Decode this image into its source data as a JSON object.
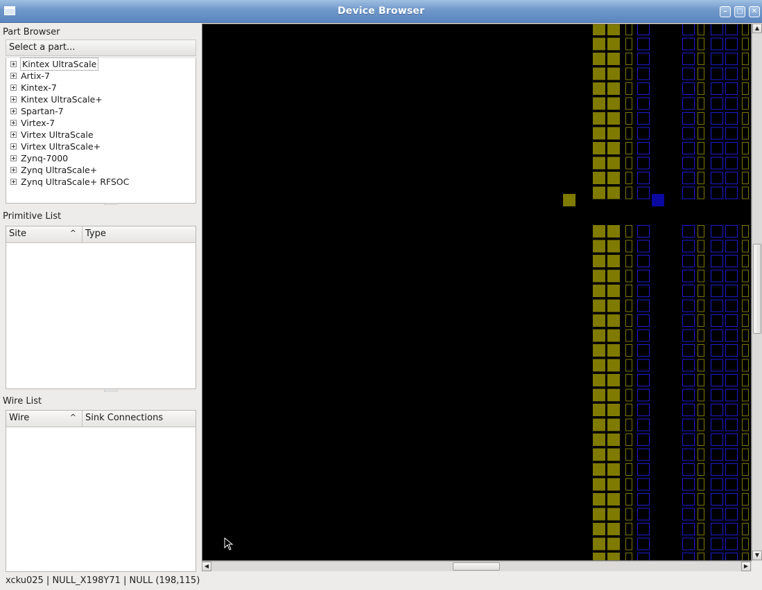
{
  "window": {
    "title": "Device Browser",
    "buttons": [
      "minimize",
      "maximize",
      "close"
    ]
  },
  "part_browser": {
    "title": "Part Browser",
    "selector_label": "Select a part...",
    "parts": [
      "Kintex UltraScale",
      "Artix-7",
      "Kintex-7",
      "Kintex UltraScale+",
      "Spartan-7",
      "Virtex-7",
      "Virtex UltraScale",
      "Virtex UltraScale+",
      "Zynq-7000",
      "Zynq UltraScale+",
      "Zynq UltraScale+ RFSOC"
    ]
  },
  "primitive_list": {
    "title": "Primitive List",
    "columns": [
      "Site",
      "Type"
    ],
    "sort_indicator": "^",
    "rows": []
  },
  "wire_list": {
    "title": "Wire List",
    "columns": [
      "Wire",
      "Sink Connections"
    ],
    "sort_indicator": "^",
    "rows": []
  },
  "status": {
    "text": "xcku025 | NULL_X198Y71 | NULL (198,115)"
  },
  "colors": {
    "tile_olive": "#7f7a00",
    "tile_blue_outline": "#1b1bd6",
    "tile_blue_fill": "#0a0aa0",
    "canvas_bg": "#000000"
  }
}
